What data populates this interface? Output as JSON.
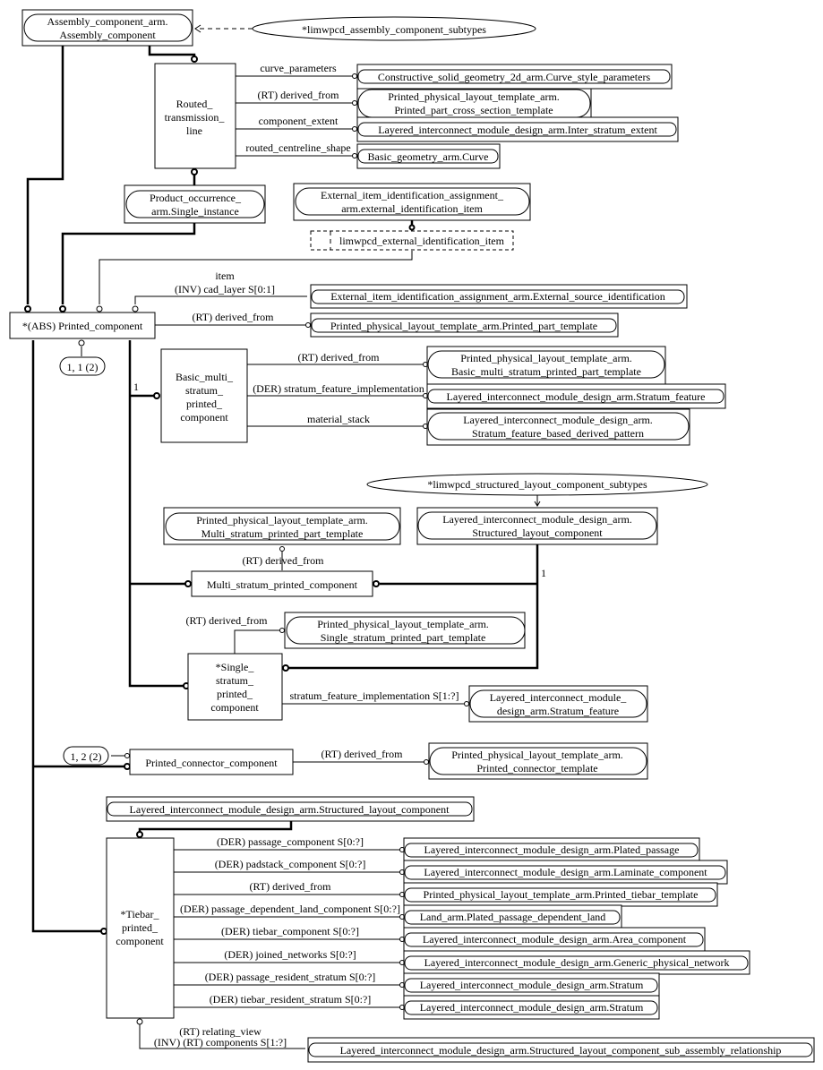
{
  "diagram": {
    "type": "EXPRESS-G schema diagram",
    "entities": {
      "assembly_component": [
        "Assembly_component_arm.",
        "Assembly_component"
      ],
      "assembly_subtypes": "*limwpcd_assembly_component_subtypes",
      "routed_transmission_line": [
        "Routed_",
        "transmission_",
        "line"
      ],
      "curve_style_parameters": "Constructive_solid_geometry_2d_arm.Curve_style_parameters",
      "printed_part_cross_section_template": [
        "Printed_physical_layout_template_arm.",
        "Printed_part_cross_section_template"
      ],
      "inter_stratum_extent": "Layered_interconnect_module_design_arm.Inter_stratum_extent",
      "basic_curve": "Basic_geometry_arm.Curve",
      "single_instance": [
        "Product_occurrence_",
        "arm.Single_instance"
      ],
      "external_identification_item": [
        "External_item_identification_assignment_",
        "arm.external_identification_item"
      ],
      "limwpcd_external_identification_item": "limwpcd_external_identification_item",
      "printed_component": "*(ABS) Printed_component",
      "external_source_identification": "External_item_identification_assignment_arm.External_source_identification",
      "printed_part_template": "Printed_physical_layout_template_arm.Printed_part_template",
      "one_of_1_1": "1, 1 (2)",
      "basic_multi_stratum": [
        "Basic_multi_",
        "stratum_",
        "printed_",
        "component"
      ],
      "basic_multi_template": [
        "Printed_physical_layout_template_arm.",
        "Basic_multi_stratum_printed_part_template"
      ],
      "stratum_feature_1": "Layered_interconnect_module_design_arm.Stratum_feature",
      "stratum_feature_based_derived_pattern": [
        "Layered_interconnect_module_design_arm.",
        "Stratum_feature_based_derived_pattern"
      ],
      "structured_layout_subtypes": "*limwpcd_structured_layout_component_subtypes",
      "multi_stratum_template": [
        "Printed_physical_layout_template_arm.",
        "Multi_stratum_printed_part_template"
      ],
      "structured_layout_component": [
        "Layered_interconnect_module_design_arm.",
        "Structured_layout_component"
      ],
      "multi_stratum_printed_component": "Multi_stratum_printed_component",
      "single_stratum_template": [
        "Printed_physical_layout_template_arm.",
        "Single_stratum_printed_part_template"
      ],
      "single_stratum_printed_component": [
        "*Single_",
        "stratum_",
        "printed_",
        "component"
      ],
      "stratum_feature_2": [
        "Layered_interconnect_module_",
        "design_arm.Stratum_feature"
      ],
      "one_of_1_2": "1, 2 (2)",
      "printed_connector_component": "Printed_connector_component",
      "printed_connector_template": [
        "Printed_physical_layout_template_arm.",
        "Printed_connector_template"
      ],
      "structured_layout_component_2": "Layered_interconnect_module_design_arm.Structured_layout_component",
      "tiebar_printed_component": [
        "*Tiebar_",
        "printed_",
        "component"
      ],
      "sub_assembly_relationship": "Layered_interconnect_module_design_arm.Structured_layout_component_sub_assembly_relationship"
    },
    "relations": {
      "curve_parameters": "curve_parameters",
      "rtl_derived_from": "(RT) derived_from",
      "component_extent": "component_extent",
      "routed_centreline_shape": "routed_centreline_shape",
      "item": "item",
      "cad_layer": "(INV) cad_layer S[0:1]",
      "pc_derived_from": "(RT) derived_from",
      "bms_derived_from": "(RT) derived_from",
      "bms_stratum_feature_implementation": "(DER) stratum_feature_implementation",
      "material_stack": "material_stack",
      "cardinality_1a": "1",
      "ms_derived_from": "(RT) derived_from",
      "cardinality_1b": "1",
      "ss_derived_from": "(RT) derived_from",
      "ss_stratum_feature_implementation": "stratum_feature_implementation S[1:?]",
      "conn_derived_from": "(RT) derived_from",
      "relating_view": "(RT) relating_view",
      "components": "(INV) (RT) components S[1:?]"
    },
    "tiebar_attributes": [
      {
        "label": "(DER) passage_component S[0:?]",
        "target": "Layered_interconnect_module_design_arm.Plated_passage"
      },
      {
        "label": "(DER) padstack_component S[0:?]",
        "target": "Layered_interconnect_module_design_arm.Laminate_component"
      },
      {
        "label": "(RT) derived_from",
        "target": "Printed_physical_layout_template_arm.Printed_tiebar_template"
      },
      {
        "label": "(DER) passage_dependent_land_component S[0:?]",
        "target": "Land_arm.Plated_passage_dependent_land"
      },
      {
        "label": "(DER) tiebar_component S[0:?]",
        "target": "Layered_interconnect_module_design_arm.Area_component"
      },
      {
        "label": "(DER) joined_networks S[0:?]",
        "target": "Layered_interconnect_module_design_arm.Generic_physical_network"
      },
      {
        "label": "(DER) passage_resident_stratum S[0:?]",
        "target": "Layered_interconnect_module_design_arm.Stratum"
      },
      {
        "label": "(DER) tiebar_resident_stratum S[0:?]",
        "target": "Layered_interconnect_module_design_arm.Stratum"
      }
    ]
  }
}
